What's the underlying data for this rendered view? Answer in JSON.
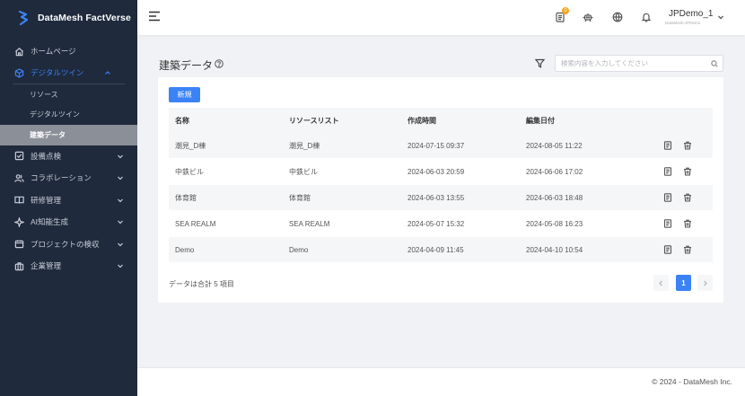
{
  "brand": {
    "name": "DataMesh FactVerse",
    "color": "#3b82f6"
  },
  "sidebar": {
    "items": [
      {
        "label": "ホームページ",
        "icon": "home-icon"
      },
      {
        "label": "デジタルツイン",
        "icon": "cube-icon"
      },
      {
        "label": "設備点検",
        "icon": "checklist-icon"
      },
      {
        "label": "コラボレーション",
        "icon": "users-icon"
      },
      {
        "label": "研修管理",
        "icon": "book-icon"
      },
      {
        "label": "AI知能生成",
        "icon": "ai-icon"
      },
      {
        "label": "プロジェクトの検収",
        "icon": "calendar-icon"
      },
      {
        "label": "企業管理",
        "icon": "briefcase-icon"
      }
    ],
    "submenu": [
      {
        "label": "リソース"
      },
      {
        "label": "デジタルツイン"
      },
      {
        "label": "建築データ"
      }
    ]
  },
  "header": {
    "notification_count": "0",
    "user_name": "JPDemo_1",
    "user_sub": "DataMesh-JPDemo"
  },
  "main": {
    "title": "建築データ",
    "search_placeholder": "検索内容を入力してください",
    "new_button": "新規",
    "columns": [
      "名称",
      "リソースリスト",
      "作成時間",
      "編集日付"
    ],
    "rows": [
      {
        "name": "潮見_D棟",
        "resource": "潮見_D棟",
        "created": "2024-07-15 09:37",
        "edited": "2024-08-05 11:22"
      },
      {
        "name": "中鉄ビル",
        "resource": "中鉄ビル",
        "created": "2024-06-03 20:59",
        "edited": "2024-06-06 17:02"
      },
      {
        "name": "体育館",
        "resource": "体育館",
        "created": "2024-06-03 13:55",
        "edited": "2024-06-03 18:48"
      },
      {
        "name": "SEA REALM",
        "resource": "SEA REALM",
        "created": "2024-05-07 15:32",
        "edited": "2024-05-08 16:23"
      },
      {
        "name": "Demo",
        "resource": "Demo",
        "created": "2024-04-09 11:45",
        "edited": "2024-04-10 10:54"
      }
    ],
    "total_text": "データは合計 5 項目",
    "current_page": "1"
  },
  "footer": {
    "text": "© 2024 - DataMesh Inc."
  }
}
